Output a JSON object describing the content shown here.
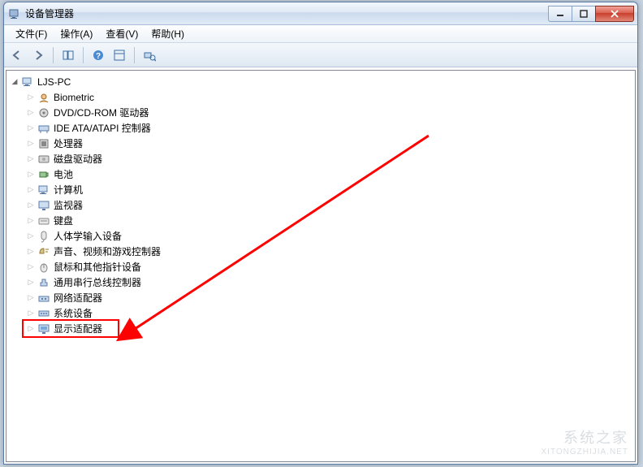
{
  "window": {
    "title": "设备管理器"
  },
  "menu": {
    "file": "文件(F)",
    "action": "操作(A)",
    "view": "查看(V)",
    "help": "帮助(H)"
  },
  "tree": {
    "root": "LJS-PC",
    "items": [
      "Biometric",
      "DVD/CD-ROM 驱动器",
      "IDE ATA/ATAPI 控制器",
      "处理器",
      "磁盘驱动器",
      "电池",
      "计算机",
      "监视器",
      "键盘",
      "人体学输入设备",
      "声音、视频和游戏控制器",
      "鼠标和其他指针设备",
      "通用串行总线控制器",
      "网络适配器",
      "系统设备",
      "显示适配器"
    ]
  },
  "watermark": {
    "cn": "系统之家",
    "en": "XITONGZHIJIA.NET"
  }
}
